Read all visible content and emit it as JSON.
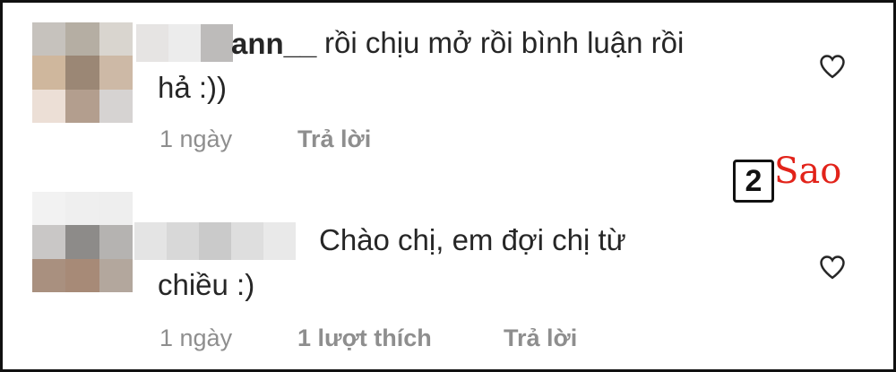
{
  "comments": [
    {
      "username_visible": "ann__",
      "text_line1": "rồi chịu mở rồi bình luận rồi",
      "text_line2": "hả :))",
      "time": "1 ngày",
      "likes": "",
      "reply": "Trả lời",
      "heart_icon": "heart-outline-icon"
    },
    {
      "username_visible": "",
      "text_line1": "Chào chị, em đợi chị từ",
      "text_line2": "chiều :)",
      "time": "1 ngày",
      "likes": "1 lượt thích",
      "reply": "Trả lời",
      "heart_icon": "heart-outline-icon"
    }
  ],
  "watermark": {
    "number": "2",
    "word": "Sao",
    "color": "#e2231a"
  },
  "colors": {
    "text": "#262626",
    "meta": "#8e8e8e",
    "border": "#111111"
  }
}
